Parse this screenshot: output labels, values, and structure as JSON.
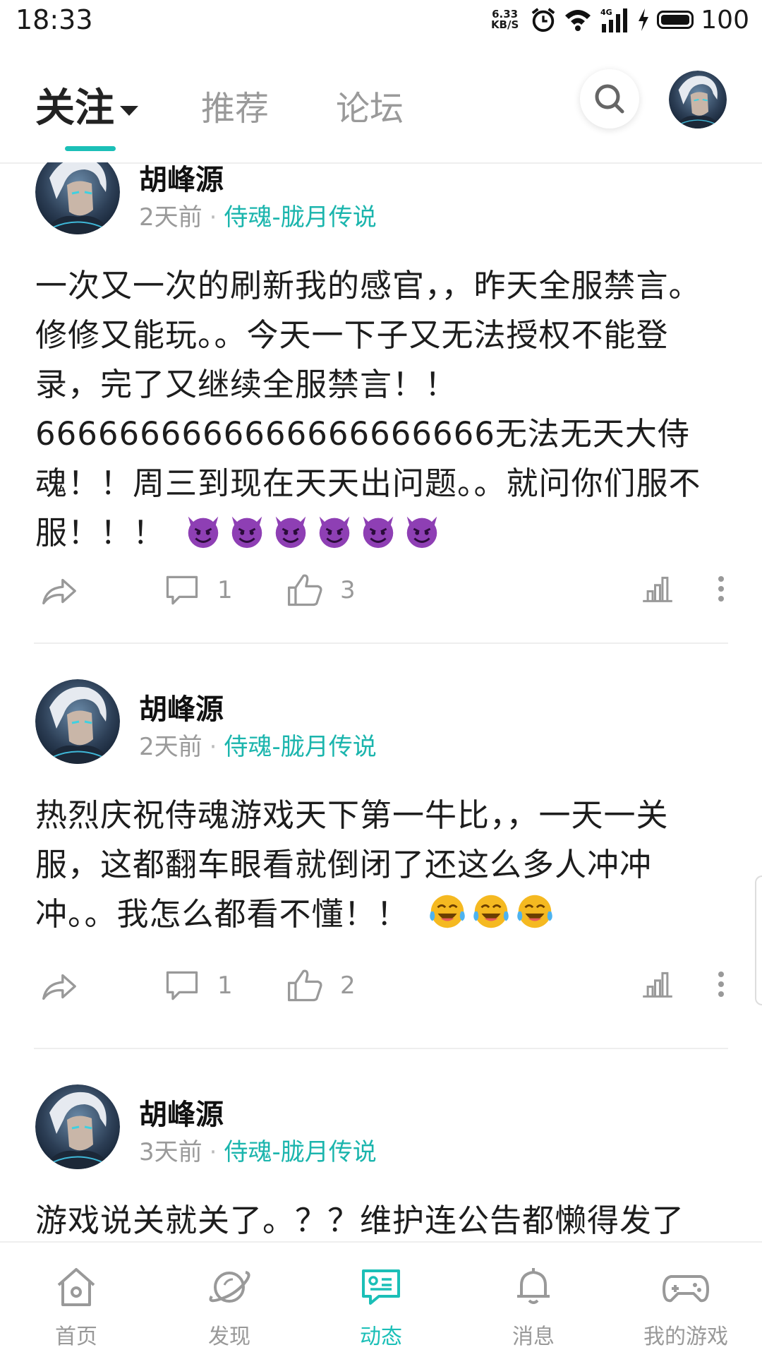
{
  "status_bar": {
    "time": "18:33",
    "net_speed_value": "6.33",
    "net_speed_unit": "KB/S",
    "battery": "100"
  },
  "top_nav": {
    "tabs": [
      {
        "label": "关注"
      },
      {
        "label": "推荐"
      },
      {
        "label": "论坛"
      }
    ]
  },
  "colors": {
    "accent": "#1bbfb7",
    "emoji_devil": "#8e3fb4",
    "emoji_laugh": "#f5b921"
  },
  "posts": [
    {
      "username": "胡峰源",
      "time": "2天前",
      "game": "侍魂-胧月传说",
      "content": "一次又一次的刷新我的感官，，昨天全服禁言。修修又能玩。。今天一下子又无法授权不能登录，完了又继续全服禁言！！6666666666666666666666无法无天大侍魂！！周三到现在天天出问题。。就问你们服不服！！！",
      "emoji": "devil",
      "emoji_count": 6,
      "comments": "1",
      "likes": "3"
    },
    {
      "username": "胡峰源",
      "time": "2天前",
      "game": "侍魂-胧月传说",
      "content": "热烈庆祝侍魂游戏天下第一牛比，，一天一关服，这都翻车眼看就倒闭了还这么多人冲冲冲。。我怎么都看不懂！！",
      "emoji": "tears-of-joy",
      "emoji_count": 3,
      "comments": "1",
      "likes": "2"
    },
    {
      "username": "胡峰源",
      "time": "3天前",
      "game": "侍魂-胧月传说",
      "content": "游戏说关就关了。？？维护连公告都懒得发了"
    }
  ],
  "bottom_nav": {
    "items": [
      {
        "label": "首页"
      },
      {
        "label": "发现"
      },
      {
        "label": "动态"
      },
      {
        "label": "消息"
      },
      {
        "label": "我的游戏"
      }
    ]
  }
}
